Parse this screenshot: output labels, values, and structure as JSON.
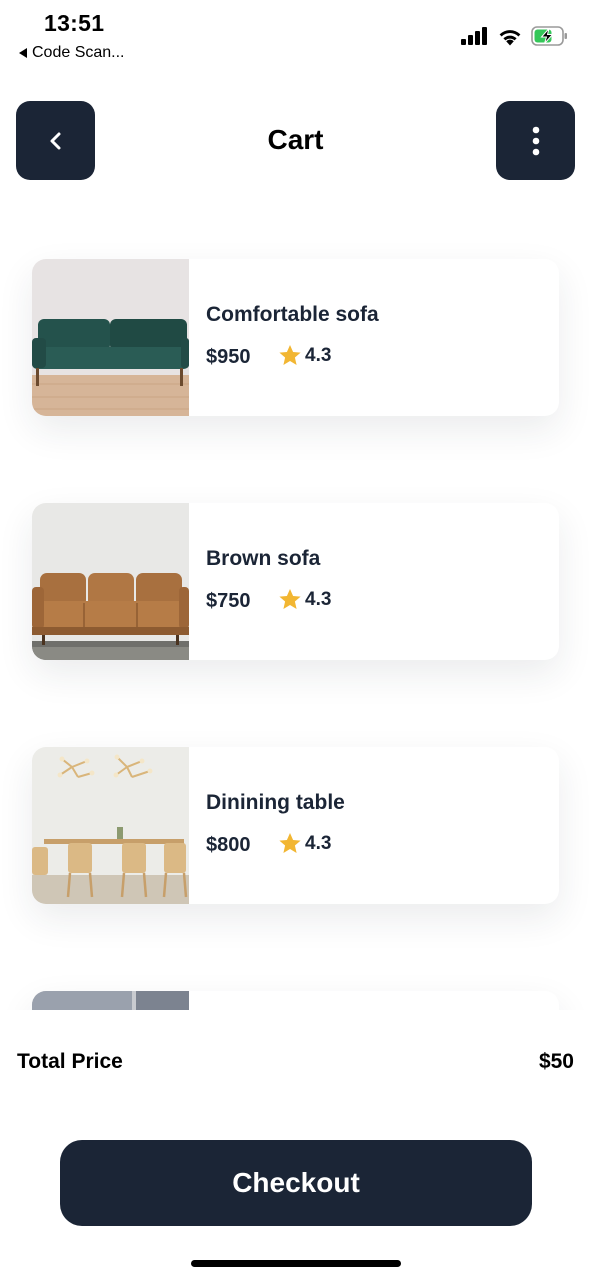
{
  "status_bar": {
    "time": "13:51",
    "back_app": "Code Scan...",
    "icons": [
      "signal-icon",
      "wifi-icon",
      "battery-charging-icon"
    ]
  },
  "header": {
    "title": "Cart",
    "back_icon": "chevron-left-icon",
    "menu_icon": "more-vertical-icon"
  },
  "colors": {
    "primary": "#1b2536",
    "star": "#f2b632",
    "background": "#ffffff"
  },
  "items": [
    {
      "name": "Comfortable sofa",
      "price": "$950",
      "rating": "4.3",
      "image": "green-sofa-image"
    },
    {
      "name": "Brown sofa",
      "price": "$750",
      "rating": "4.3",
      "image": "brown-sofa-image"
    },
    {
      "name": "Dinining table",
      "price": "$800",
      "rating": "4.3",
      "image": "dining-table-image"
    },
    {
      "name": "",
      "price": "",
      "rating": "",
      "image": "partial-item-image"
    }
  ],
  "total": {
    "label": "Total Price",
    "value": "$50"
  },
  "checkout": {
    "label": "Checkout"
  }
}
